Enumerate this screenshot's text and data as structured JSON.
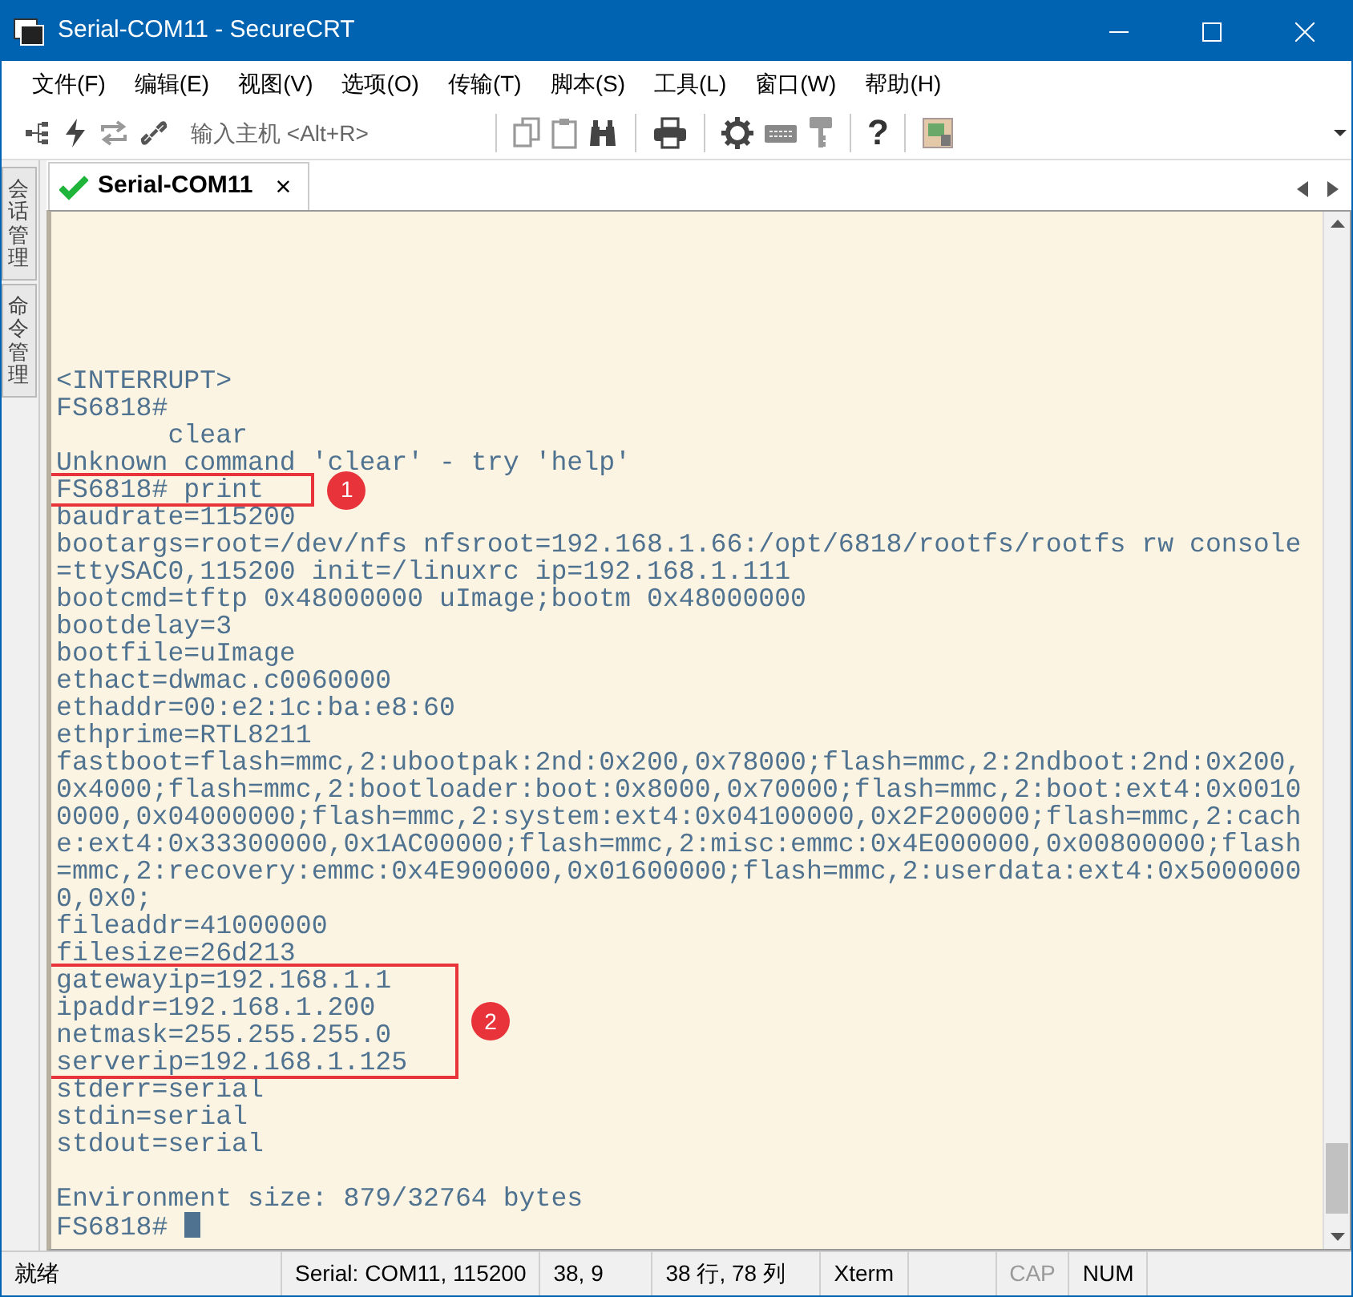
{
  "window": {
    "title": "Serial-COM11 - SecureCRT"
  },
  "menu": [
    "文件(F)",
    "编辑(E)",
    "视图(V)",
    "选项(O)",
    "传输(T)",
    "脚本(S)",
    "工具(L)",
    "窗口(W)",
    "帮助(H)"
  ],
  "toolbar": {
    "host_placeholder": "输入主机 <Alt+R>",
    "help_glyph": "?"
  },
  "side_tabs": [
    "会话管理",
    "命令管理"
  ],
  "tabs": [
    {
      "label": "Serial-COM11",
      "connected": true,
      "selected": true,
      "close": "×"
    }
  ],
  "terminal": {
    "lines": [
      {
        "text": "<INTERRUPT>"
      },
      {
        "text": "FS6818#"
      },
      {
        "text": "       clear"
      },
      {
        "text": "Unknown command 'clear' - try 'help'"
      },
      {
        "kind": "annotated",
        "label": "1",
        "lines": [
          {
            "text": "FS6818# print"
          }
        ]
      },
      {
        "text": "baudrate=115200"
      },
      {
        "text": "bootargs=root=/dev/nfs nfsroot=192.168.1.66:/opt/6818/rootfs/rootfs rw console"
      },
      {
        "text": "=ttySAC0,115200 init=/linuxrc ip=192.168.1.111"
      },
      {
        "text": "bootcmd=tftp 0x48000000 uImage;bootm 0x48000000"
      },
      {
        "text": "bootdelay=3"
      },
      {
        "text": "bootfile=uImage"
      },
      {
        "text": "ethact=dwmac.c0060000"
      },
      {
        "text": "ethaddr=00:e2:1c:ba:e8:60"
      },
      {
        "text": "ethprime=RTL8211"
      },
      {
        "text": "fastboot=flash=mmc,2:ubootpak:2nd:0x200,0x78000;flash=mmc,2:2ndboot:2nd:0x200,"
      },
      {
        "text": "0x4000;flash=mmc,2:bootloader:boot:0x8000,0x70000;flash=mmc,2:boot:ext4:0x0010"
      },
      {
        "text": "0000,0x04000000;flash=mmc,2:system:ext4:0x04100000,0x2F200000;flash=mmc,2:cach"
      },
      {
        "text": "e:ext4:0x33300000,0x1AC00000;flash=mmc,2:misc:emmc:0x4E000000,0x00800000;flash"
      },
      {
        "text": "=mmc,2:recovery:emmc:0x4E900000,0x01600000;flash=mmc,2:userdata:ext4:0x5000000"
      },
      {
        "text": "0,0x0;"
      },
      {
        "text": "fileaddr=41000000"
      },
      {
        "text": "filesize=26d213"
      },
      {
        "kind": "annotated",
        "label": "2",
        "lines": [
          {
            "text": "gatewayip=192.168.1.1"
          },
          {
            "text": "ipaddr=192.168.1.200"
          },
          {
            "text": "netmask=255.255.255.0"
          },
          {
            "text": "serverip=192.168.1.125"
          }
        ]
      },
      {
        "text": "stderr=serial"
      },
      {
        "text": "stdin=serial"
      },
      {
        "text": "stdout=serial"
      },
      {
        "text": "Environment size: 879/32764 bytes",
        "gap_before": true
      },
      {
        "text": "FS6818# ",
        "cursor": true
      }
    ]
  },
  "status_bar": [
    {
      "text": "就绪"
    },
    {
      "text": "Serial: COM11, 115200"
    },
    {
      "text": "38,   9"
    },
    {
      "text": "38 行, 78 列"
    },
    {
      "text": "Xterm"
    },
    {
      "text": "CAP",
      "disabled": true
    },
    {
      "text": "NUM",
      "disabled": false
    }
  ]
}
